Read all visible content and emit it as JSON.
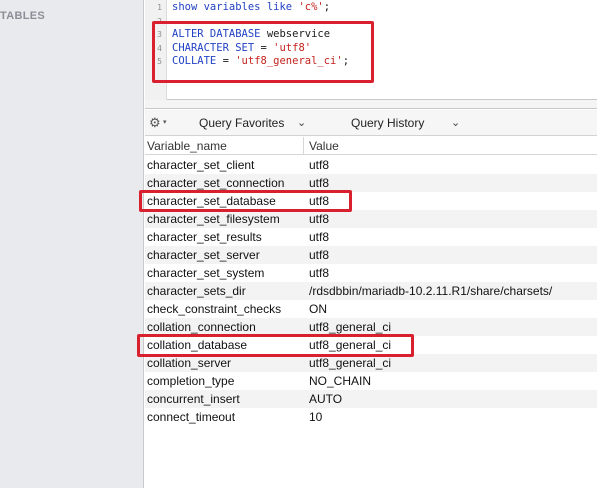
{
  "sidebar": {
    "title": "TABLES"
  },
  "editor": {
    "line_numbers": [
      "1",
      "2",
      "3",
      "4",
      "5"
    ],
    "line1": {
      "kw": "show variables like",
      "str": "'c%'",
      "end": ";"
    },
    "line3": {
      "kw": "ALTER DATABASE",
      "text": " webservice"
    },
    "line4": {
      "kw": "CHARACTER SET",
      "text": " = ",
      "str": "'utf8'"
    },
    "line5": {
      "kw": "COLLATE",
      "text": " = ",
      "str": "'utf8_general_ci'",
      "end": ";"
    }
  },
  "toolbar": {
    "gear_icon": "gear-icon",
    "query_favorites_label": "Query Favorites",
    "query_history_label": "Query History"
  },
  "grid": {
    "columns": [
      "Variable_name",
      "Value"
    ],
    "rows": [
      {
        "name": "character_set_client",
        "value": "utf8"
      },
      {
        "name": "character_set_connection",
        "value": "utf8"
      },
      {
        "name": "character_set_database",
        "value": "utf8"
      },
      {
        "name": "character_set_filesystem",
        "value": "utf8"
      },
      {
        "name": "character_set_results",
        "value": "utf8"
      },
      {
        "name": "character_set_server",
        "value": "utf8"
      },
      {
        "name": "character_set_system",
        "value": "utf8"
      },
      {
        "name": "character_sets_dir",
        "value": "/rdsdbbin/mariadb-10.2.11.R1/share/charsets/"
      },
      {
        "name": "check_constraint_checks",
        "value": "ON"
      },
      {
        "name": "collation_connection",
        "value": "utf8_general_ci"
      },
      {
        "name": "collation_database",
        "value": "utf8_general_ci"
      },
      {
        "name": "collation_server",
        "value": "utf8_general_ci"
      },
      {
        "name": "completion_type",
        "value": "NO_CHAIN"
      },
      {
        "name": "concurrent_insert",
        "value": "AUTO"
      },
      {
        "name": "connect_timeout",
        "value": "10"
      }
    ]
  },
  "annotations": {
    "highlight_color": "#d8202f"
  }
}
